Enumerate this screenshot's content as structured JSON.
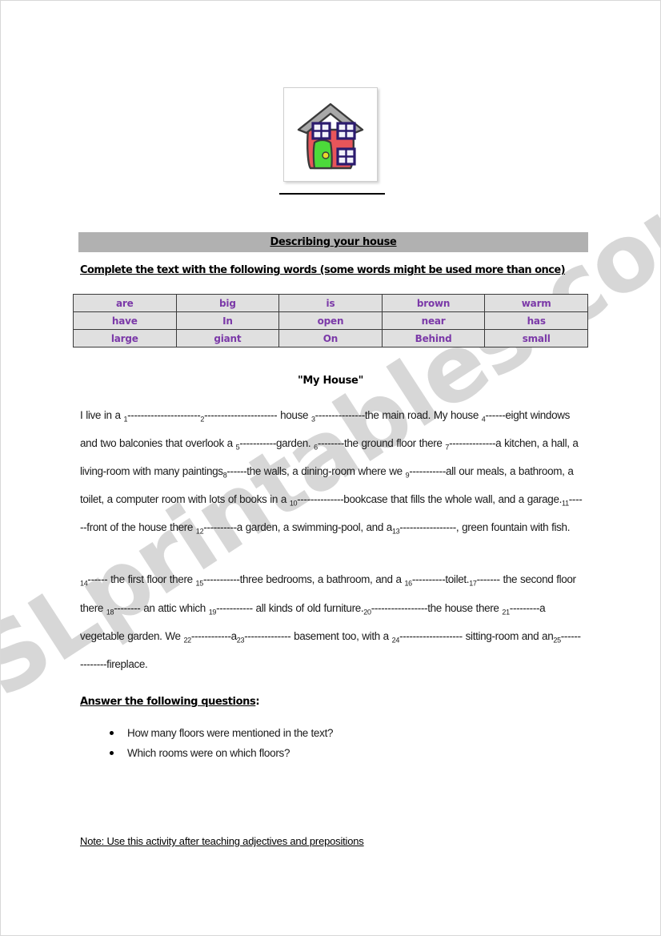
{
  "document": {
    "watermark": "ESLprintables.com",
    "banner_title": "Describing your house",
    "instruction": "Complete the text with the following words (some words might be used more than once)",
    "passage_title": "\"My House\""
  },
  "illustration": {
    "name": "house-clipart",
    "roof_color": "#a8a8a8",
    "wall_color": "#e8555a",
    "door_color": "#4cd93a",
    "window_frame_color": "#2b1b6e",
    "window_pane_color": "#f2f2fa",
    "knob_color": "#e8d92b",
    "outline_color": "#3a3a3a"
  },
  "word_bank": {
    "rows": [
      [
        "are",
        "big",
        "is",
        "brown",
        "warm"
      ],
      [
        "have",
        "In",
        "open",
        "near",
        "has"
      ],
      [
        "large",
        "giant",
        "On",
        "Behind",
        "small"
      ]
    ],
    "text_color": "#7b39a8",
    "cell_background": "#e0e0e0"
  },
  "passage": {
    "paragraph_1": [
      {
        "text": "I live in a "
      },
      {
        "blank": "1"
      },
      {
        "dashes": "----------------------"
      },
      {
        "blank": "2"
      },
      {
        "dashes": "----------------------"
      },
      {
        "text": " house "
      },
      {
        "blank": "3"
      },
      {
        "dashes": "---------------"
      },
      {
        "text": "the main road. My house "
      },
      {
        "blank": "4"
      },
      {
        "dashes": "------"
      },
      {
        "text": "eight windows and two balconies that overlook a "
      },
      {
        "blank": "5"
      },
      {
        "dashes": "-----------"
      },
      {
        "text": "garden. "
      },
      {
        "blank": "6"
      },
      {
        "dashes": "--------"
      },
      {
        "text": "the ground floor there "
      },
      {
        "blank": "7"
      },
      {
        "dashes": "--------------"
      },
      {
        "text": "a kitchen, a hall, a living-room with many paintings"
      },
      {
        "blank": "8"
      },
      {
        "dashes": "------"
      },
      {
        "text": "the walls, a dining-room where we "
      },
      {
        "blank": "9"
      },
      {
        "dashes": "-----------"
      },
      {
        "text": "all our meals, a bathroom, a toilet, a computer room with lots of books in a "
      },
      {
        "blank": "10"
      },
      {
        "dashes": "--------------"
      },
      {
        "text": "bookcase that fills the whole wall, and a garage."
      },
      {
        "blank": "11"
      },
      {
        "dashes": "------"
      },
      {
        "text": "front of the house there "
      },
      {
        "blank": "12"
      },
      {
        "dashes": "----------"
      },
      {
        "text": "a garden, a swimming-pool, and a"
      },
      {
        "blank": "13"
      },
      {
        "dashes": "-----------------"
      },
      {
        "text": ", green fountain with fish."
      }
    ],
    "paragraph_2": [
      {
        "blank": "14"
      },
      {
        "dashes": "------"
      },
      {
        "text": " the first floor there "
      },
      {
        "blank": "15"
      },
      {
        "dashes": "-----------"
      },
      {
        "text": "three bedrooms, a bathroom, and a "
      },
      {
        "blank": "16"
      },
      {
        "dashes": "----------"
      },
      {
        "text": "toilet."
      },
      {
        "blank": "17"
      },
      {
        "dashes": "-------"
      },
      {
        "text": " the second floor there "
      },
      {
        "blank": "18"
      },
      {
        "dashes": "--------"
      },
      {
        "text": " an attic which "
      },
      {
        "blank": "19"
      },
      {
        "dashes": "-----------"
      },
      {
        "text": " all kinds of old furniture."
      },
      {
        "blank": "20"
      },
      {
        "dashes": "-----------------"
      },
      {
        "text": "the house there "
      },
      {
        "blank": "21"
      },
      {
        "dashes": "---------"
      },
      {
        "text": "a vegetable garden. We "
      },
      {
        "blank": "22"
      },
      {
        "dashes": "------------"
      },
      {
        "text": "a"
      },
      {
        "blank": "23"
      },
      {
        "dashes": "--------------"
      },
      {
        "text": " basement too, with a "
      },
      {
        "blank": "24"
      },
      {
        "dashes": "-------------------"
      },
      {
        "text": " sitting-room and an"
      },
      {
        "blank": "25"
      },
      {
        "dashes": "--------------"
      },
      {
        "text": "fireplace."
      }
    ]
  },
  "questions": {
    "heading": "Answer the following questions",
    "heading_suffix": ":",
    "items": [
      "How many floors were mentioned in the text?",
      "Which rooms were on which floors?"
    ]
  },
  "note": "Note: Use this activity after teaching adjectives and prepositions"
}
